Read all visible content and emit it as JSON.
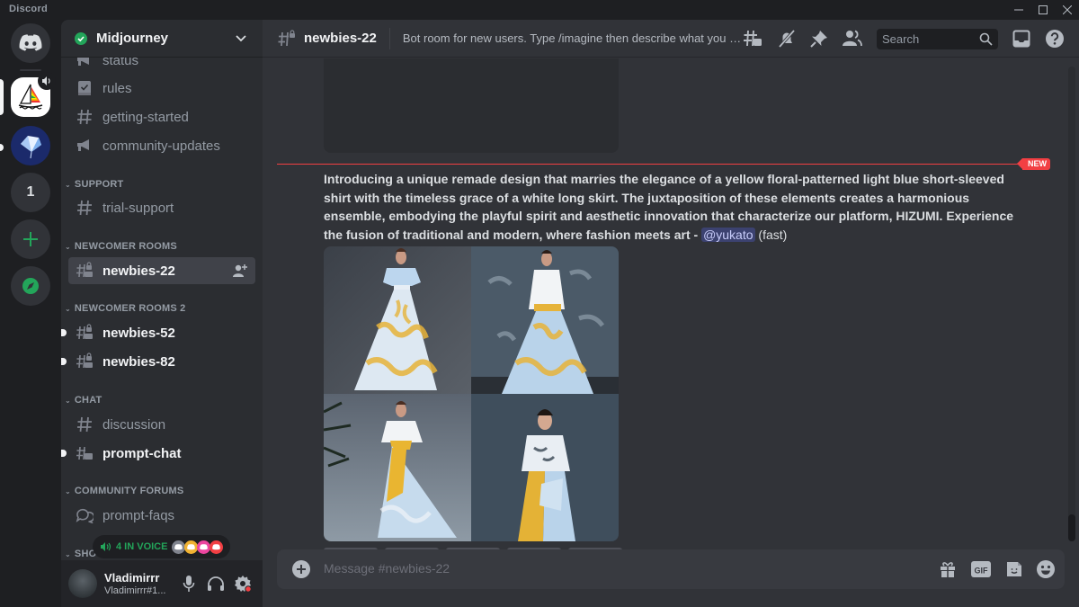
{
  "window": {
    "app_name": "Discord",
    "controls": {
      "minimize": "—",
      "maximize": "☐",
      "close": "✕"
    }
  },
  "rail": {
    "home_icon": "discord-logo-icon",
    "servers": [
      {
        "name": "Midjourney",
        "icon": "sailboat-icon",
        "active": true,
        "voice_active": true
      },
      {
        "name": "Crystal server",
        "icon": "crystal-icon",
        "unread": true
      },
      {
        "name": "1",
        "label": "1"
      },
      {
        "name": "Add a Server",
        "label": "+"
      },
      {
        "name": "Explore Discoverable Servers",
        "icon": "compass-icon"
      }
    ]
  },
  "sidebar": {
    "guild_name": "Midjourney",
    "guild_verified": true,
    "channels_top": [
      {
        "name": "status",
        "icon": "announcement-icon"
      },
      {
        "name": "rules",
        "icon": "rules-icon"
      },
      {
        "name": "getting-started",
        "icon": "hash-icon"
      },
      {
        "name": "community-updates",
        "icon": "announcement-icon"
      }
    ],
    "categories": [
      {
        "name": "SUPPORT",
        "channels": [
          {
            "name": "trial-support",
            "icon": "hash-icon"
          }
        ]
      },
      {
        "name": "NEWCOMER ROOMS",
        "channels": [
          {
            "name": "newbies-22",
            "icon": "locked-thread-hash-icon",
            "active": true
          }
        ]
      },
      {
        "name": "NEWCOMER ROOMS 2",
        "channels": [
          {
            "name": "newbies-52",
            "icon": "locked-thread-hash-icon",
            "unread": true
          },
          {
            "name": "newbies-82",
            "icon": "locked-thread-hash-icon",
            "unread": true
          }
        ]
      },
      {
        "name": "CHAT",
        "channels": [
          {
            "name": "discussion",
            "icon": "hash-icon"
          },
          {
            "name": "prompt-chat",
            "icon": "thread-hash-icon",
            "unread": true
          }
        ]
      },
      {
        "name": "COMMUNITY FORUMS",
        "channels": [
          {
            "name": "prompt-faqs",
            "icon": "forum-icon"
          }
        ]
      },
      {
        "name": "SHOWCASE",
        "visible_text": "SHO"
      }
    ],
    "voice": {
      "label": "4 IN VOICE",
      "avatar_colors": [
        "#80848e",
        "#f0b232",
        "#eb459f",
        "#f23f43"
      ]
    },
    "user": {
      "display_name": "Vladimirrr",
      "tag": "Vladimirrr#1...",
      "has_settings_alert": true
    }
  },
  "header": {
    "channel_name": "newbies-22",
    "topic": "Bot room for new users. Type /imagine then describe what you want to draw. See https://docs.midjourney.com/ for more information",
    "search_placeholder": "Search",
    "icons": [
      "threads-icon",
      "mute-notifications-icon",
      "pinned-icon",
      "member-list-icon",
      "inbox-icon",
      "help-icon"
    ]
  },
  "messages": {
    "new_badge": "NEW",
    "current": {
      "prompt_text": "Introducing a unique remade design that marries the elegance of a yellow floral-patterned light blue short-sleeved shirt with the timeless grace of a white long skirt. The juxtaposition of these elements creates a harmonious ensemble, embodying the playful spirit and aesthetic innovation that characterize our platform, HIZUMI. Experience the fusion of traditional and modern, where fashion meets art - ",
      "mention": "@yukato",
      "suffix": " (fast)",
      "image_grid": [
        {
          "alt": "Model in light blue short-sleeved shirt and white skirt with yellow floral pattern"
        },
        {
          "alt": "Model in white shirt with yellow belt and light blue floral skirt before a grey wall"
        },
        {
          "alt": "Model in white shirt with large yellow sash bow and light blue floral skirt"
        },
        {
          "alt": "Model in white floral blouse with yellow and light blue layered skirt"
        }
      ]
    }
  },
  "composer": {
    "placeholder": "Message #newbies-22",
    "icons": [
      "add-attachment-icon",
      "gift-icon",
      "gif-icon",
      "sticker-icon",
      "emoji-icon"
    ],
    "gif_label": "GIF"
  },
  "colors": {
    "brand": "#5865f2",
    "online_green": "#23a55a",
    "new_red": "#f23f43",
    "mention_bg": "#3c4270"
  }
}
